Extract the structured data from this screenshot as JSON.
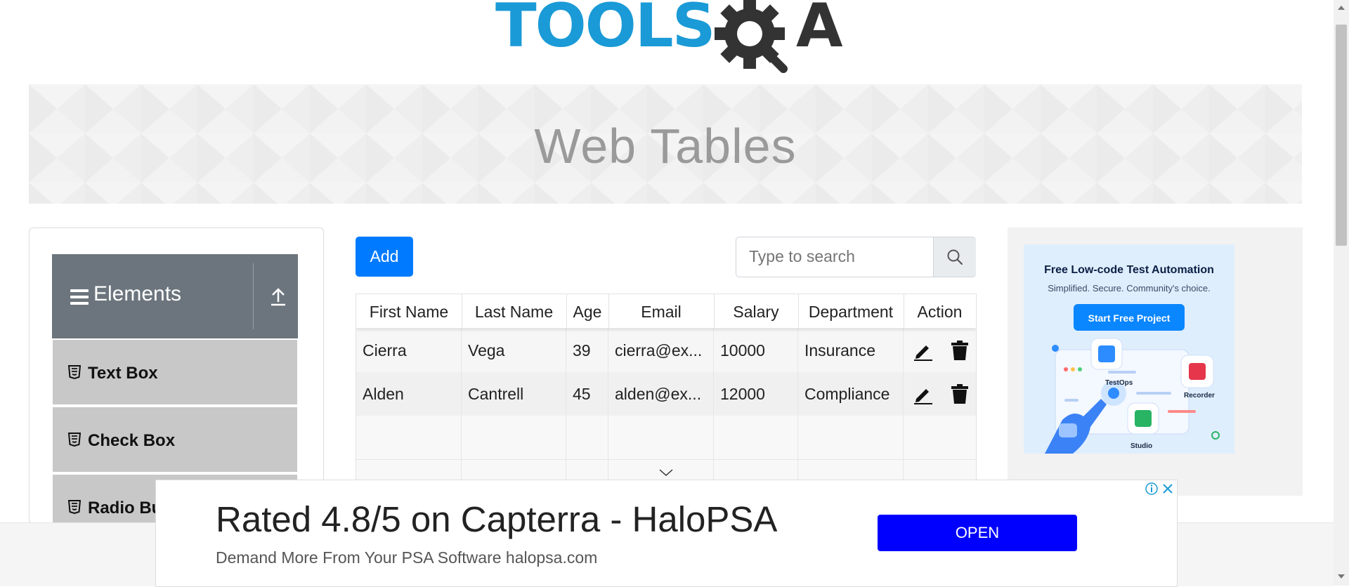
{
  "header": {
    "logo_text": "TOOLS",
    "logo_suffix": "A"
  },
  "banner": {
    "title": "Web Tables"
  },
  "sidebar": {
    "group": "Elements",
    "items": [
      {
        "label": "Text Box"
      },
      {
        "label": "Check Box"
      },
      {
        "label": "Radio Bu"
      }
    ]
  },
  "toolbar": {
    "add_label": "Add",
    "search_placeholder": "Type to search"
  },
  "table": {
    "columns": [
      "First Name",
      "Last Name",
      "Age",
      "Email",
      "Salary",
      "Department",
      "Action"
    ],
    "rows": [
      {
        "first": "Cierra",
        "last": "Vega",
        "age": "39",
        "email": "cierra@ex...",
        "salary": "10000",
        "department": "Insurance"
      },
      {
        "first": "Alden",
        "last": "Cantrell",
        "age": "45",
        "email": "alden@ex...",
        "salary": "12000",
        "department": "Compliance"
      }
    ]
  },
  "side_ad": {
    "headline": "Free Low-code Test Automation",
    "subline": "Simplified. Secure. Community's choice.",
    "cta": "Start Free Project",
    "labels": [
      "TestOps",
      "Recorder",
      "Studio"
    ]
  },
  "bottom_ad": {
    "headline": "Rated 4.8/5 on Capterra - HaloPSA",
    "subline": "Demand More From Your PSA Software halopsa.com",
    "cta": "OPEN"
  },
  "colors": {
    "primary": "#007bff",
    "group_header": "#6c757d",
    "menu_item": "#c8c8c8",
    "logo_blue": "#1a9ad6",
    "ad_button": "#0000ff"
  }
}
